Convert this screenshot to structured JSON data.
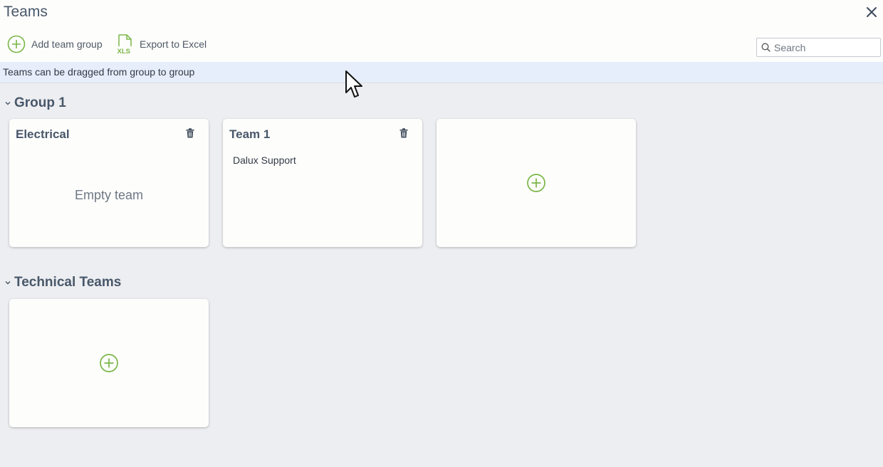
{
  "window": {
    "title": "Teams"
  },
  "toolbar": {
    "add_group_label": "Add team group",
    "export_label": "Export to Excel",
    "export_icon_text": "XLS"
  },
  "search": {
    "placeholder": "Search",
    "value": ""
  },
  "info": {
    "text": "Teams can be dragged from group to group"
  },
  "groups": [
    {
      "name": "Group 1",
      "teams": [
        {
          "name": "Electrical",
          "empty_label": "Empty team",
          "members": []
        },
        {
          "name": "Team 1",
          "members": [
            "Dalux Support"
          ]
        }
      ]
    },
    {
      "name": "Technical Teams",
      "teams": []
    }
  ],
  "colors": {
    "accent_green": "#7ab648",
    "text_heading": "#48576a",
    "background": "#edeef1",
    "info_bar": "#e7eefb"
  },
  "icons": {
    "close": "close-icon",
    "add": "plus-circle-icon",
    "export": "xls-file-icon",
    "search": "search-icon",
    "delete": "trash-icon",
    "collapse": "chevron-down-icon"
  }
}
